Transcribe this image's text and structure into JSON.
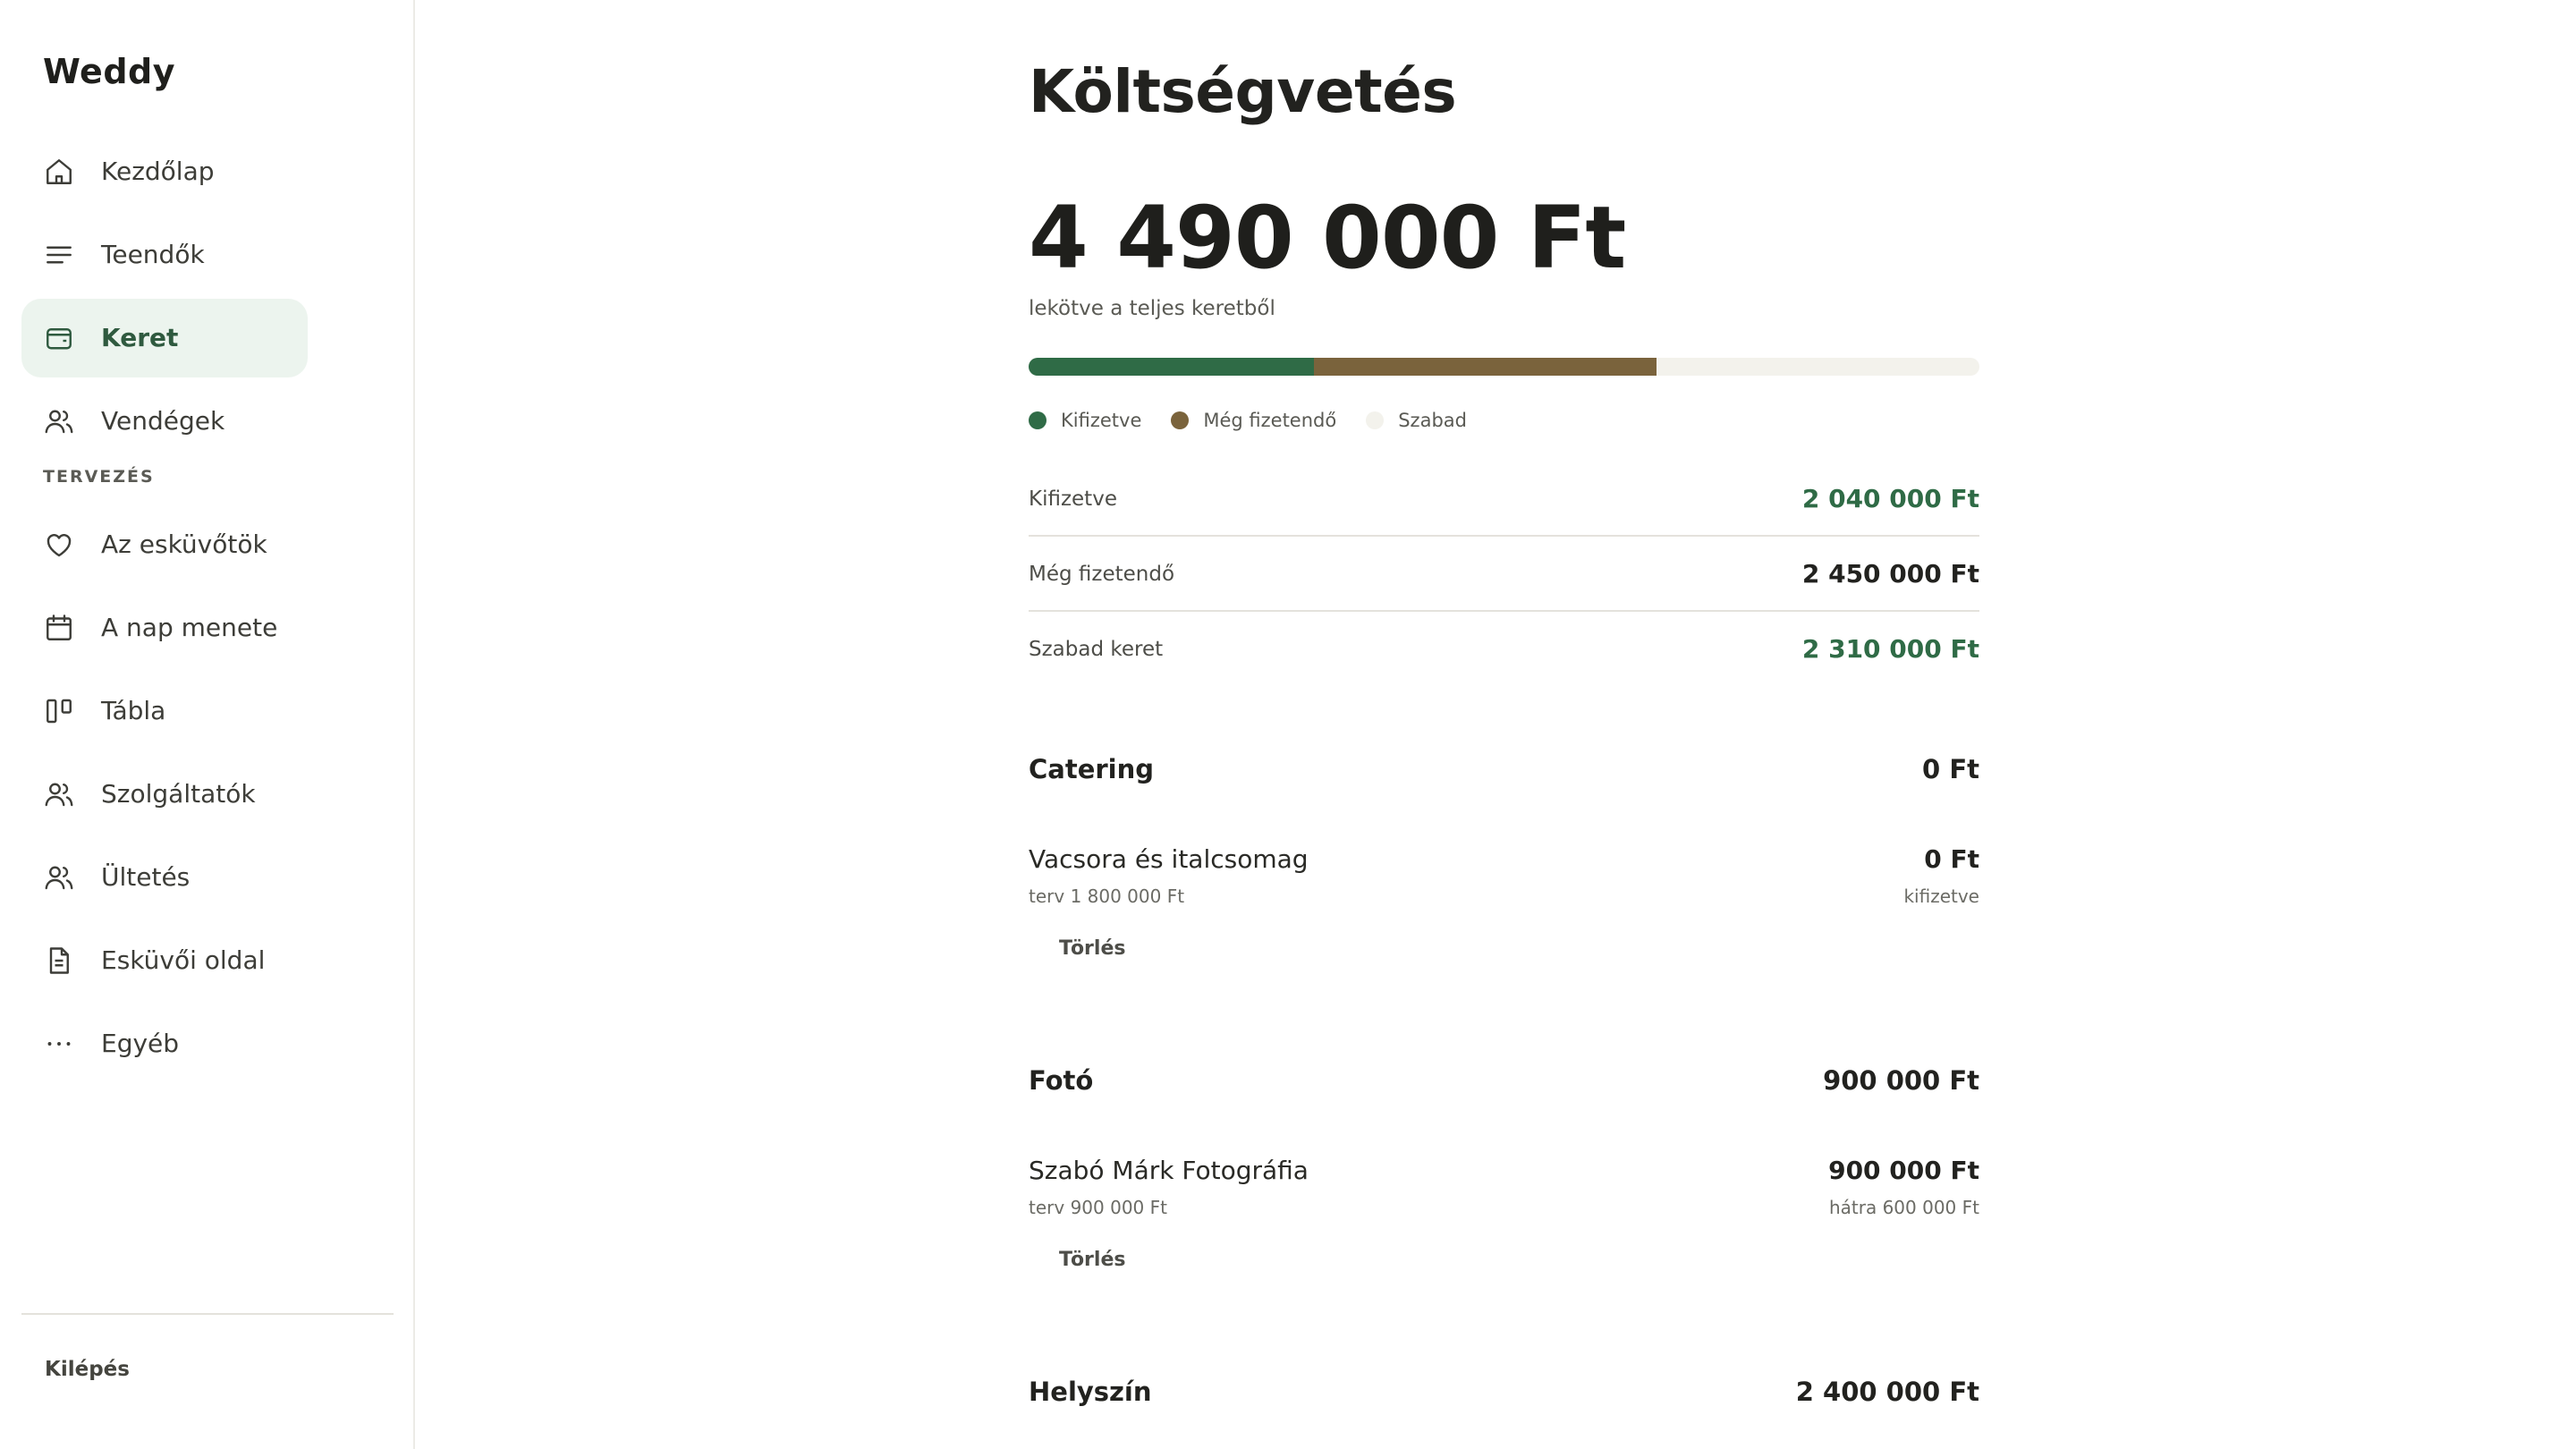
{
  "app": {
    "name": "Weddy"
  },
  "sidebar": {
    "items": [
      {
        "label": "Kezdőlap",
        "icon": "home-icon"
      },
      {
        "label": "Teendők",
        "icon": "list-icon"
      },
      {
        "label": "Keret",
        "icon": "wallet-icon",
        "active": true
      },
      {
        "label": "Vendégek",
        "icon": "users-icon"
      }
    ],
    "section_label": "TERVEZÉS",
    "planning_items": [
      {
        "label": "Az esküvőtök",
        "icon": "heart-icon"
      },
      {
        "label": "A nap menete",
        "icon": "calendar-icon"
      },
      {
        "label": "Tábla",
        "icon": "board-icon"
      },
      {
        "label": "Szolgáltatók",
        "icon": "users-icon"
      },
      {
        "label": "Ültetés",
        "icon": "users-icon"
      },
      {
        "label": "Esküvői oldal",
        "icon": "document-icon"
      },
      {
        "label": "Egyéb",
        "icon": "more-icon"
      }
    ],
    "logout_label": "Kilépés"
  },
  "budget": {
    "title": "Költségvetés",
    "committed_total": "4 490 000 Ft",
    "committed_sub": "lekötve a teljes keretből",
    "progress": {
      "paid_fraction": 0.3,
      "due_fraction": 0.36,
      "free_fraction": 0.34
    },
    "colors": {
      "paid": "#2f6b46",
      "due": "#7a633c",
      "free": "#f3f2ec"
    },
    "legend": [
      {
        "label": "Kifizetve",
        "color": "#2f6b46"
      },
      {
        "label": "Még fizetendő",
        "color": "#7a633c"
      },
      {
        "label": "Szabad",
        "color": "#f3f2ec"
      }
    ],
    "summary": [
      {
        "label": "Kifizetve",
        "value": "2 040 000 Ft"
      },
      {
        "label": "Még fizetendő",
        "value": "2 450 000 Ft"
      },
      {
        "label": "Szabad keret",
        "value": "2 310 000 Ft"
      }
    ],
    "categories": [
      {
        "name": "Catering",
        "amount": "0 Ft",
        "items": [
          {
            "name": "Vacsora és italcsomag",
            "plan": "terv 1 800 000 Ft",
            "amount": "0 Ft",
            "status": "kifizetve",
            "delete_label": "Törlés"
          }
        ]
      },
      {
        "name": "Fotó",
        "amount": "900 000 Ft",
        "items": [
          {
            "name": "Szabó Márk Fotográfia",
            "plan": "terv 900 000 Ft",
            "amount": "900 000 Ft",
            "status": "hátra 600 000 Ft",
            "delete_label": "Törlés"
          }
        ]
      },
      {
        "name": "Helyszín",
        "amount": "2 400 000 Ft",
        "items": []
      }
    ]
  }
}
